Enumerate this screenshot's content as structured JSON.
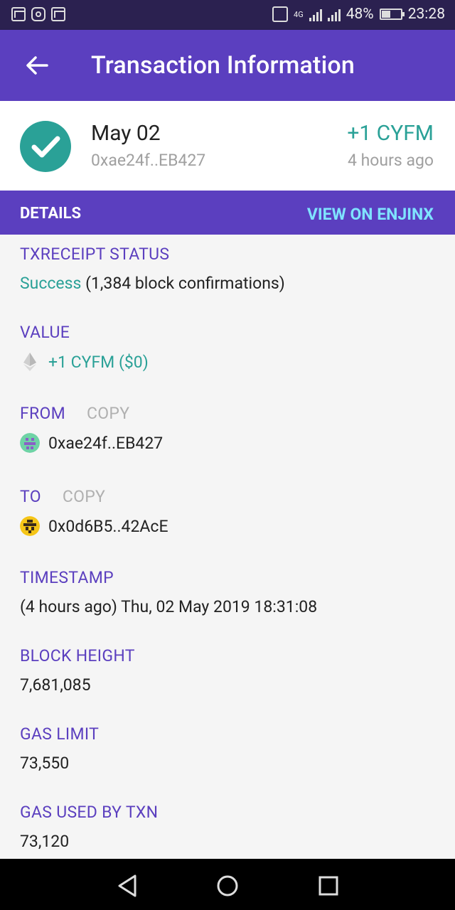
{
  "status_bar": {
    "battery": "48%",
    "time": "23:28",
    "network": "4G",
    "battery_level": 0.48
  },
  "app_bar": {
    "title": "Transaction Information"
  },
  "summary": {
    "date": "May 02",
    "address": "0xae24f..EB427",
    "amount": "+1 CYFM",
    "time_ago": "4 hours ago"
  },
  "details_bar": {
    "label": "DETAILS",
    "link": "VIEW ON ENJINX"
  },
  "fields": {
    "txreceipt": {
      "label": "TXRECEIPT STATUS",
      "status": "Success",
      "detail": "(1,384 block confirmations)"
    },
    "value": {
      "label": "VALUE",
      "value": "+1 CYFM ($0)"
    },
    "from": {
      "label": "FROM",
      "copy": "COPY",
      "address": "0xae24f..EB427"
    },
    "to": {
      "label": "TO",
      "copy": "COPY",
      "address": "0x0d6B5..42AcE"
    },
    "timestamp": {
      "label": "TIMESTAMP",
      "value": "(4 hours ago) Thu, 02 May 2019 18:31:08"
    },
    "block_height": {
      "label": "BLOCK HEIGHT",
      "value": "7,681,085"
    },
    "gas_limit": {
      "label": "GAS LIMIT",
      "value": "73,550"
    },
    "gas_used": {
      "label": "GAS USED BY TXN",
      "value": "73,120"
    }
  },
  "colors": {
    "primary": "#5b3fbf",
    "teal": "#2aa197",
    "link": "#7fe3ff"
  },
  "icons": [
    "back-arrow-icon",
    "success-check-icon",
    "ethereum-icon",
    "identicon-avatar",
    "nav-back-icon",
    "nav-home-icon",
    "nav-recents-icon"
  ]
}
